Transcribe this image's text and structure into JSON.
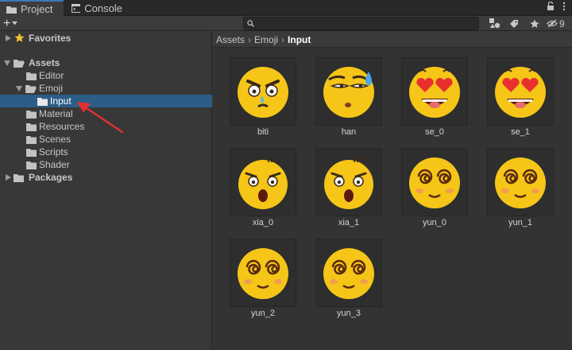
{
  "tabs": [
    {
      "label": "Project",
      "icon": "folder-icon",
      "active": true
    },
    {
      "label": "Console",
      "icon": "console-icon",
      "active": false
    }
  ],
  "toolbar": {
    "add_label": "+",
    "search_placeholder": "",
    "hidden_count": "9"
  },
  "tree": {
    "favorites": "Favorites",
    "assets": "Assets",
    "editor": "Editor",
    "emoji": "Emoji",
    "input": "Input",
    "material": "Material",
    "resources": "Resources",
    "scenes": "Scenes",
    "scripts": "Scripts",
    "shader": "Shader",
    "packages": "Packages"
  },
  "breadcrumb": [
    "Assets",
    "Emoji",
    "Input"
  ],
  "assets": [
    {
      "name": "biti",
      "expr": "angry-sweat"
    },
    {
      "name": "han",
      "expr": "cold-sweat"
    },
    {
      "name": "se_0",
      "expr": "heart-eyes"
    },
    {
      "name": "se_1",
      "expr": "heart-eyes"
    },
    {
      "name": "xia_0",
      "expr": "scared"
    },
    {
      "name": "xia_1",
      "expr": "scared"
    },
    {
      "name": "yun_0",
      "expr": "dizzy"
    },
    {
      "name": "yun_1",
      "expr": "dizzy"
    },
    {
      "name": "yun_2",
      "expr": "dizzy"
    },
    {
      "name": "yun_3",
      "expr": "dizzy"
    }
  ],
  "colors": {
    "selection": "#2c5d87",
    "tab_accent": "#3a79bb",
    "annotation_arrow": "#e03030",
    "emoji_yellow": "#f5c518"
  }
}
